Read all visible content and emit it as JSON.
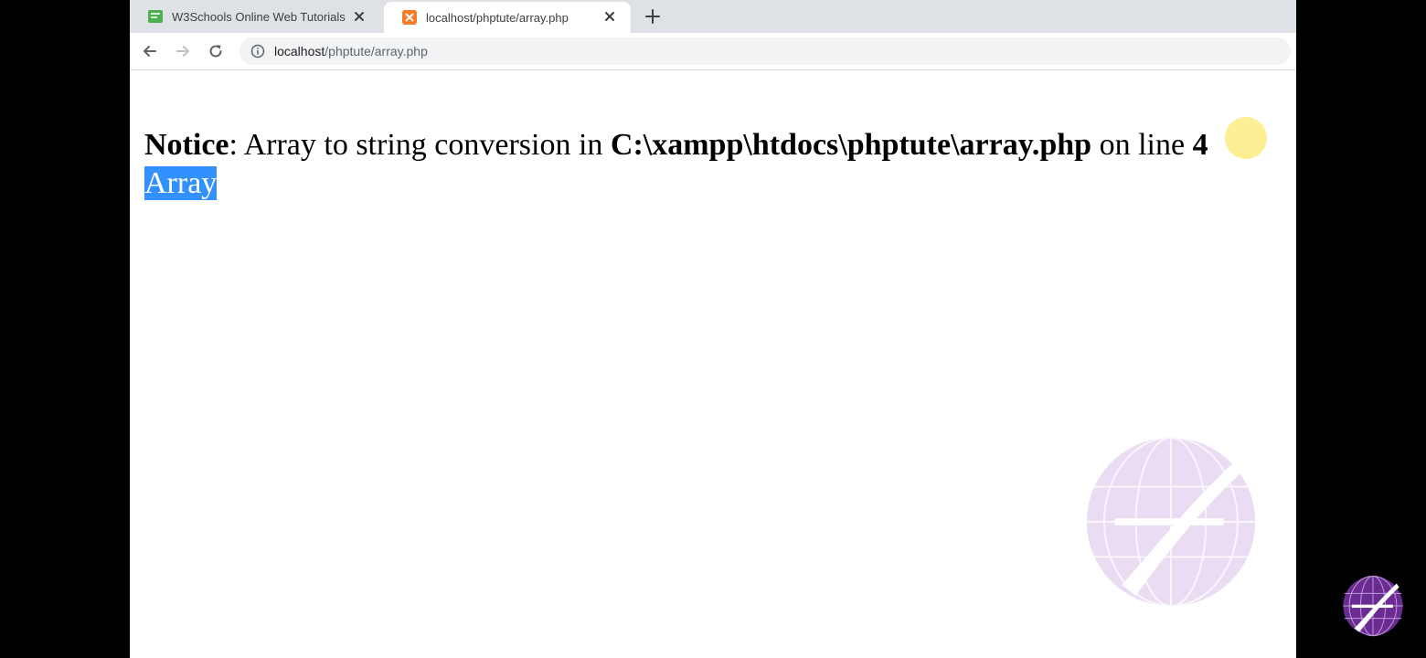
{
  "browser": {
    "tabs": [
      {
        "title": "W3Schools Online Web Tutorials",
        "active": false,
        "favicon": "w3schools-icon"
      },
      {
        "title": "localhost/phptute/array.php",
        "active": true,
        "favicon": "xampp-icon"
      }
    ],
    "address": {
      "host": "localhost",
      "path": "/phptute/array.php"
    }
  },
  "page": {
    "notice_label": "Notice",
    "notice_message": ": Array to string conversion in ",
    "file_path": "C:\\xampp\\htdocs\\phptute\\array.php",
    "on_line_text": " on line ",
    "line_number": "4",
    "output_text": "Array"
  },
  "colors": {
    "tab_strip": "#dee1e6",
    "selection": "#3390ff",
    "watermark": "#9b59b6",
    "logo": "#6a2c91"
  }
}
